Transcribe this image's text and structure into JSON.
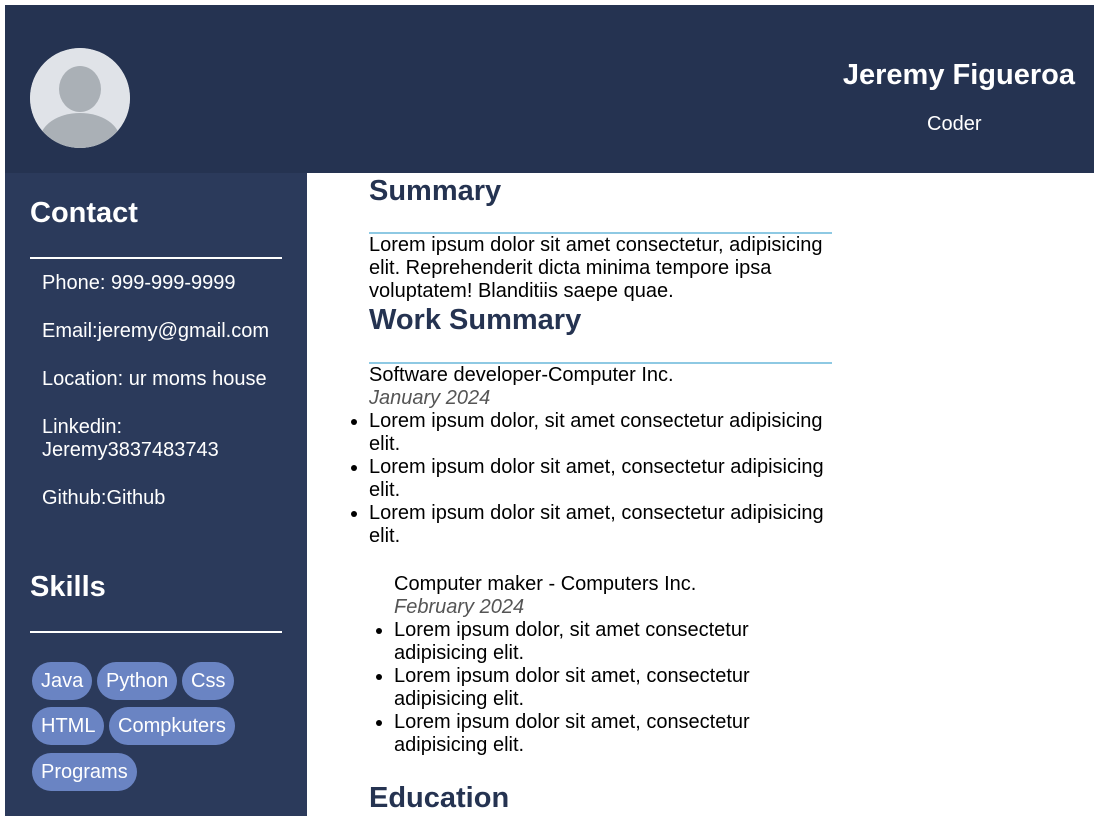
{
  "header": {
    "name": "Jeremy Figueroa",
    "role": "Coder"
  },
  "sidebar": {
    "contact_heading": "Contact",
    "contact_items": [
      "Phone: 999-999-9999",
      "Email:jeremy@gmail.com",
      "Location: ur moms house",
      "Linkedin: Jeremy3837483743",
      "Github:Github"
    ],
    "skills_heading": "Skills",
    "skills": [
      "Java",
      "Python",
      "Css",
      "HTML",
      "Compkuters",
      "Programs"
    ]
  },
  "main": {
    "summary_heading": "Summary",
    "summary_text": "Lorem ipsum dolor sit amet consectetur, adipisicing elit. Reprehenderit dicta minima tempore ipsa voluptatem! Blanditiis saepe quae.",
    "work_heading": "Work Summary",
    "jobs": [
      {
        "title": "Software developer-Computer Inc.",
        "date": "January 2024",
        "bullets": [
          "Lorem ipsum dolor, sit amet consectetur adipisicing elit.",
          "Lorem ipsum dolor sit amet, consectetur adipisicing elit.",
          "Lorem ipsum dolor sit amet, consectetur adipisicing elit."
        ]
      },
      {
        "title": "Computer maker - Computers Inc.",
        "date": "February 2024",
        "bullets": [
          "Lorem ipsum dolor, sit amet consectetur adipisicing elit.",
          "Lorem ipsum dolor sit amet, consectetur adipisicing elit.",
          "Lorem ipsum dolor sit amet, consectetur adipisicing elit."
        ]
      }
    ],
    "education_heading": "Education"
  },
  "colors": {
    "header_bg": "#253351",
    "sidebar_bg": "#2b3a5b",
    "skill_pill": "#6a84c3",
    "section_rule": "#8ec9e3",
    "heading_text": "#253351"
  }
}
